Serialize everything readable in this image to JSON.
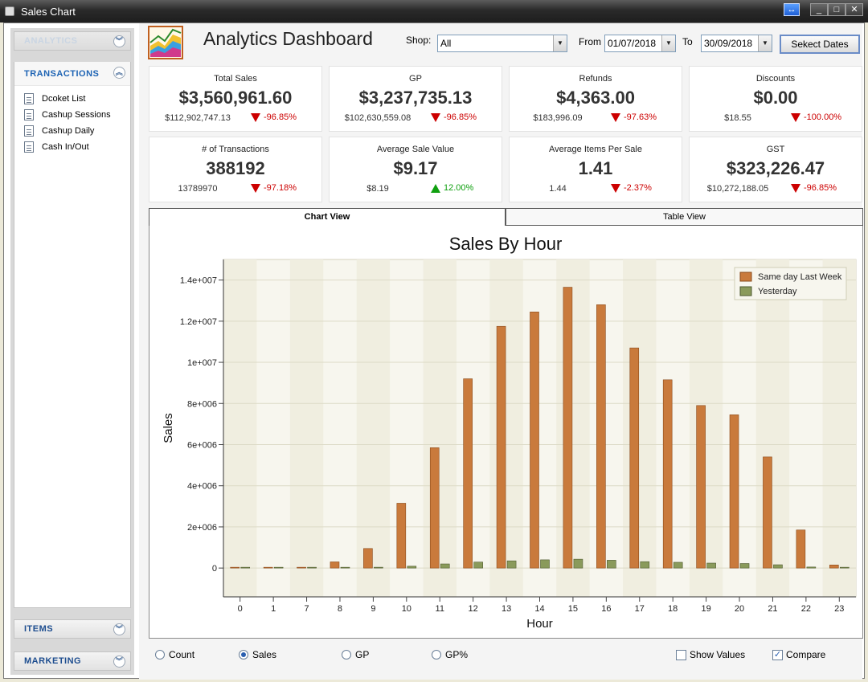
{
  "window": {
    "title": "Sales Chart"
  },
  "sidebar": {
    "analytics_label": "ANALYTICS",
    "transactions_label": "TRANSACTIONS",
    "items": [
      {
        "label": "Dcoket List"
      },
      {
        "label": "Cashup Sessions"
      },
      {
        "label": "Cashup Daily"
      },
      {
        "label": "Cash In/Out"
      }
    ],
    "items_label": "ITEMS",
    "marketing_label": "MARKETING"
  },
  "header": {
    "title": "Analytics Dashboard",
    "shop_label": "Shop:",
    "shop_value": "All",
    "from_label": "From",
    "from_value": "01/07/2018",
    "to_label": "To",
    "to_value": "30/09/2018",
    "select_button": "Sekect Dates"
  },
  "cards": [
    {
      "title": "Total Sales",
      "value": "$3,560,961.60",
      "prev": "$112,902,747.13",
      "change": "-96.85%",
      "dir": "down"
    },
    {
      "title": "GP",
      "value": "$3,237,735.13",
      "prev": "$102,630,559.08",
      "change": "-96.85%",
      "dir": "down"
    },
    {
      "title": "Refunds",
      "value": "$4,363.00",
      "prev": "$183,996.09",
      "change": "-97.63%",
      "dir": "down"
    },
    {
      "title": "Discounts",
      "value": "$0.00",
      "prev": "$18.55",
      "change": "-100.00%",
      "dir": "down"
    },
    {
      "title": "# of Transactions",
      "value": "388192",
      "prev": "13789970",
      "change": "-97.18%",
      "dir": "down"
    },
    {
      "title": "Average Sale Value",
      "value": "$9.17",
      "prev": "$8.19",
      "change": "12.00%",
      "dir": "up"
    },
    {
      "title": "Average Items Per Sale",
      "value": "1.41",
      "prev": "1.44",
      "change": "-2.37%",
      "dir": "down"
    },
    {
      "title": "GST",
      "value": "$323,226.47",
      "prev": "$10,272,188.05",
      "change": "-96.85%",
      "dir": "down"
    }
  ],
  "tabs": {
    "chart_view": "Chart View",
    "table_view": "Table View"
  },
  "options": {
    "count": "Count",
    "sales": "Sales",
    "gp": "GP",
    "gp_pct": "GP%",
    "show_values": "Show Values",
    "compare": "Compare",
    "selected_metric": "Sales",
    "show_values_checked": false,
    "compare_checked": true
  },
  "colors": {
    "series_last_week": "#c97a3c",
    "series_yesterday": "#8a9a5b",
    "plot_bg": "#f0eee0"
  },
  "chart_data": {
    "type": "bar",
    "title": "Sales By Hour",
    "xlabel": "Hour",
    "ylabel": "Sales",
    "categories": [
      "0",
      "1",
      "7",
      "8",
      "9",
      "10",
      "11",
      "12",
      "13",
      "14",
      "15",
      "16",
      "17",
      "18",
      "19",
      "20",
      "21",
      "22",
      "23"
    ],
    "yticks": [
      "0",
      "2e+006",
      "4e+006",
      "6e+006",
      "8e+006",
      "1e+007",
      "1.2e+007",
      "1.4e+007"
    ],
    "ylim": [
      -1400000,
      15000000
    ],
    "legend_position": "top-right",
    "series": [
      {
        "name": "Same day Last Week",
        "values": [
          20000,
          15000,
          10000,
          300000,
          950000,
          3150000,
          5850000,
          9200000,
          11750000,
          12450000,
          13650000,
          12800000,
          10700000,
          9150000,
          7900000,
          7450000,
          5400000,
          1850000,
          150000
        ]
      },
      {
        "name": "Yesterday",
        "values": [
          5000,
          3000,
          2000,
          10000,
          40000,
          90000,
          200000,
          290000,
          350000,
          400000,
          430000,
          380000,
          310000,
          280000,
          240000,
          220000,
          160000,
          50000,
          5000
        ]
      }
    ]
  }
}
